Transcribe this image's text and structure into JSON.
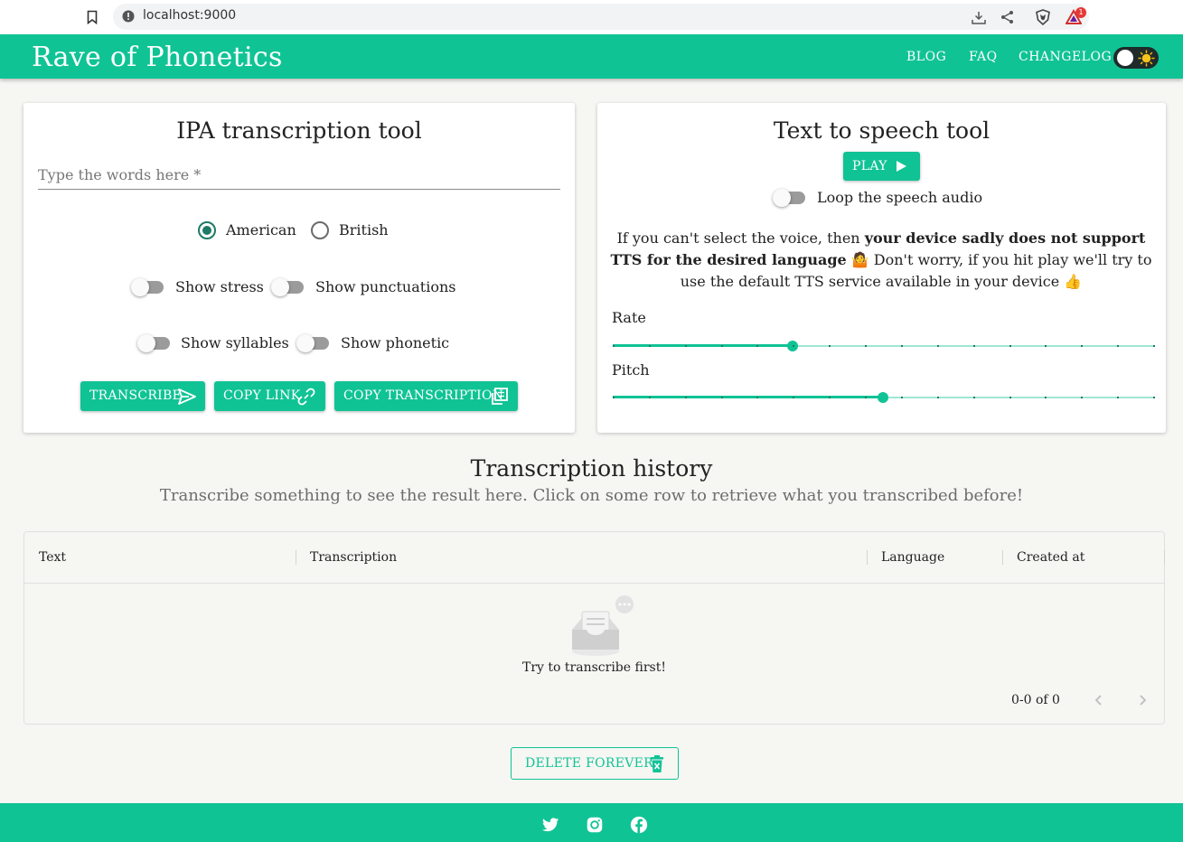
{
  "browser": {
    "url": "localhost:9000",
    "notification_count": "1"
  },
  "app": {
    "title": "Rave of Phonetics",
    "nav": [
      "BLOG",
      "FAQ",
      "CHANGELOG"
    ]
  },
  "ipa_tool": {
    "title": "IPA transcription tool",
    "input_placeholder": "Type the words here *",
    "input_value": "",
    "dialects": [
      "American",
      "British"
    ],
    "selected_dialect": "American",
    "toggles": {
      "show_stress": "Show stress",
      "show_punctuations": "Show punctuations",
      "show_syllables": "Show syllables",
      "show_phonetic": "Show phonetic"
    },
    "buttons": {
      "transcribe": "TRANSCRIBE",
      "copy_link": "COPY LINK",
      "copy_transcription": "COPY TRANSCRIPTION"
    }
  },
  "tts_tool": {
    "title": "Text to speech tool",
    "play_label": "PLAY",
    "loop_label": "Loop the speech audio",
    "notice": {
      "part1": "If you can't select the voice, then ",
      "bold": "your device sadly does not support TTS for the desired language",
      "part2": " 🤷 Don't worry, if you hit play we'll try to use the default TTS service available in your device 👍"
    },
    "rate": {
      "label": "Rate",
      "value": 5,
      "max": 15
    },
    "pitch": {
      "label": "Pitch",
      "value": 7.5,
      "max": 15
    }
  },
  "history": {
    "title": "Transcription history",
    "subtitle": "Transcribe something to see the result here. Click on some row to retrieve what you transcribed before!",
    "columns": [
      "Text",
      "Transcription",
      "Language",
      "Created at"
    ],
    "empty_text": "Try to transcribe first!",
    "pagination": "0-0 of 0",
    "delete_label": "DELETE FOREVER"
  },
  "colors": {
    "primary": "#10c395",
    "radio_selected": "#1e7a66",
    "background": "#f6f6f3"
  },
  "footer": {
    "social": [
      "twitter-icon",
      "instagram-icon",
      "facebook-icon"
    ]
  }
}
